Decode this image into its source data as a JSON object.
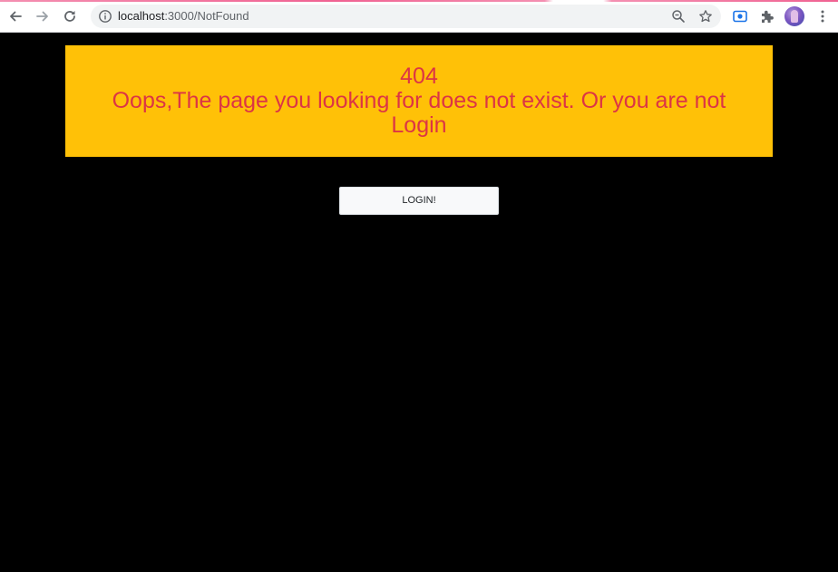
{
  "browser": {
    "url_host": "localhost",
    "url_path": ":3000/NotFound",
    "icons": {
      "back": "arrow-left-icon",
      "forward": "arrow-right-icon",
      "reload": "reload-icon",
      "site_info": "info-icon",
      "zoom": "zoom-icon",
      "bookmark": "star-icon",
      "extension_screen": "screen-capture-icon",
      "extensions": "puzzle-icon",
      "profile": "avatar",
      "menu": "kebab-menu-icon"
    },
    "accent_color": "#f06292"
  },
  "page": {
    "background": "#000000",
    "banner": {
      "code": "404",
      "message": "Oops,The page you looking for does not exist. Or you are not Login",
      "background": "#ffc107",
      "text_color": "#dc3545"
    },
    "login_button_label": "LOGIN!"
  }
}
